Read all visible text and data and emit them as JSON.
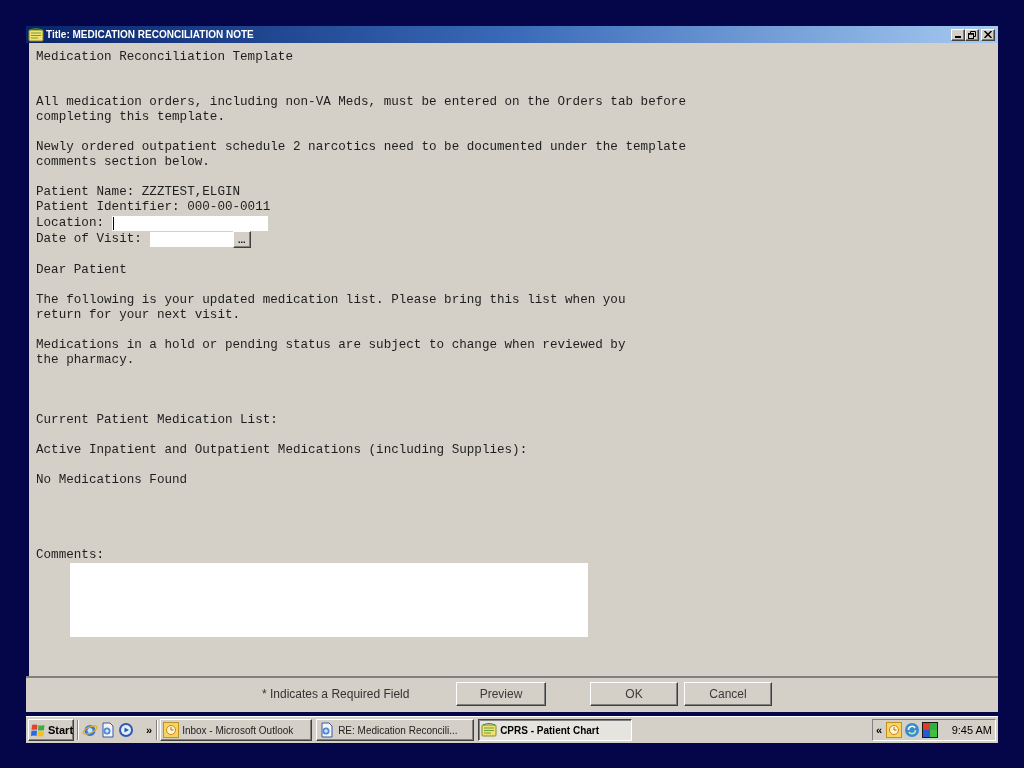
{
  "window": {
    "title": "Title: MEDICATION RECONCILIATION NOTE"
  },
  "template": {
    "heading": "Medication Reconciliation Template",
    "instructions": [
      {
        "lines": [
          "All medication orders, including non-VA Meds, must be entered on the Orders tab before",
          "completing this template."
        ]
      },
      {
        "lines": [
          "Newly ordered outpatient schedule 2 narcotics need to be documented under the template",
          "comments section below."
        ]
      }
    ],
    "patient_info": [
      {
        "kind": "text",
        "text": "Patient Name: ZZZTEST,ELGIN"
      },
      {
        "kind": "text",
        "text": "Patient Identifier: 000-00-0011"
      },
      {
        "kind": "text_input",
        "label": "Location:",
        "focused": true
      },
      {
        "kind": "date_input",
        "label": "Date of Visit:",
        "button_label": "..."
      }
    ],
    "greeting": "Dear Patient",
    "letter": [
      {
        "lines": [
          "The following is your updated medication list. Please bring this list when you",
          "return for your next visit."
        ]
      },
      {
        "lines": [
          "Medications in a hold or pending status are subject to change when reviewed by",
          "the pharmacy."
        ]
      }
    ],
    "medication_list": {
      "title": "Current Patient Medication List:",
      "subtitle": "Active Inpatient and Outpatient Medications (including Supplies):",
      "empty_message": "No Medications Found"
    },
    "comments": {
      "label": "Comments:"
    }
  },
  "footer": {
    "note": "* Indicates a Required Field",
    "buttons": [
      "Preview",
      "OK",
      "Cancel"
    ]
  },
  "taskbar": {
    "start": "Start",
    "more": "»",
    "tasks": [
      {
        "label": "Inbox - Microsoft Outlook",
        "selected": false
      },
      {
        "label": "RE: Medication Reconcili...",
        "selected": false
      },
      {
        "label": "CPRS - Patient Chart",
        "selected": true
      }
    ],
    "tray": {
      "expand": "«",
      "clock": "9:45 AM"
    }
  }
}
